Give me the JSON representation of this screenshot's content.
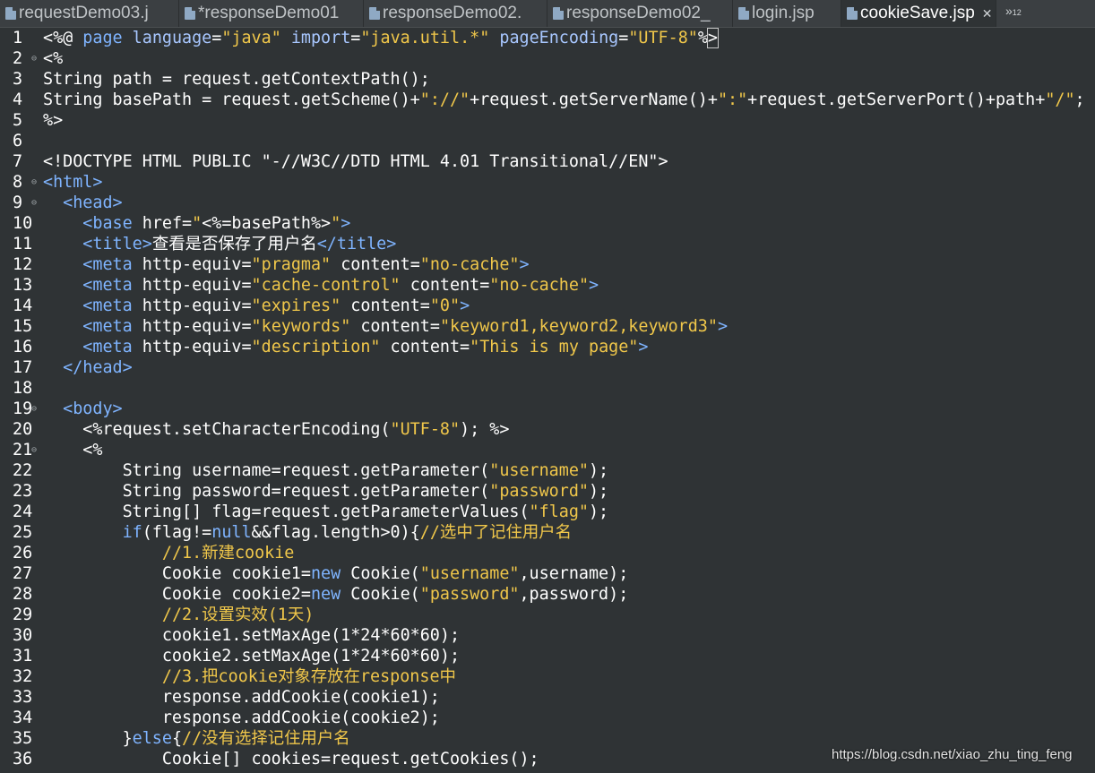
{
  "tabs": [
    {
      "label": "requestDemo03.j",
      "active": false
    },
    {
      "label": "*responseDemo01",
      "active": false
    },
    {
      "label": "responseDemo02.",
      "active": false
    },
    {
      "label": "responseDemo02_",
      "active": false
    },
    {
      "label": "login.jsp",
      "active": false
    },
    {
      "label": "cookieSave.jsp",
      "active": true
    }
  ],
  "tab_close": "✕",
  "overflow_count": "12",
  "overflow_glyph": "»",
  "colors": {
    "background": "#2f3335",
    "keyword": "#7fb4ff",
    "string": "#f0c74a",
    "text": "#ffffff"
  },
  "lines": [
    {
      "n": "1",
      "fold": false,
      "tokens": [
        [
          "plain",
          "<%@ "
        ],
        [
          "kw",
          "page"
        ],
        [
          "plain",
          " "
        ],
        [
          "attr",
          "language"
        ],
        [
          "plain",
          "="
        ],
        [
          "str",
          "\"java\""
        ],
        [
          "plain",
          " "
        ],
        [
          "attr",
          "import"
        ],
        [
          "plain",
          "="
        ],
        [
          "str",
          "\"java.util.*\""
        ],
        [
          "plain",
          " "
        ],
        [
          "attr",
          "pageEncoding"
        ],
        [
          "plain",
          "="
        ],
        [
          "str",
          "\"UTF-8\""
        ],
        [
          "plain",
          "%"
        ],
        [
          "plain",
          ">"
        ]
      ]
    },
    {
      "n": "2",
      "fold": true,
      "tokens": [
        [
          "plain",
          "<%"
        ]
      ]
    },
    {
      "n": "3",
      "fold": false,
      "tokens": [
        [
          "plain",
          "String path = request.getContextPath();"
        ]
      ]
    },
    {
      "n": "4",
      "fold": false,
      "tokens": [
        [
          "plain",
          "String basePath = request.getScheme()+"
        ],
        [
          "str",
          "\"://\""
        ],
        [
          "plain",
          "+request.getServerName()+"
        ],
        [
          "str",
          "\":\""
        ],
        [
          "plain",
          "+request.getServerPort()+path+"
        ],
        [
          "str",
          "\"/\""
        ],
        [
          "plain",
          ";"
        ]
      ]
    },
    {
      "n": "5",
      "fold": false,
      "tokens": [
        [
          "plain",
          "%>"
        ]
      ]
    },
    {
      "n": "6",
      "fold": false,
      "tokens": []
    },
    {
      "n": "7",
      "fold": false,
      "tokens": [
        [
          "plain",
          "<!DOCTYPE HTML PUBLIC \"-//W3C//DTD HTML 4.01 Transitional//EN\">"
        ]
      ]
    },
    {
      "n": "8",
      "fold": true,
      "tokens": [
        [
          "kw",
          "<html>"
        ]
      ]
    },
    {
      "n": "9",
      "fold": true,
      "tokens": [
        [
          "plain",
          "  "
        ],
        [
          "kw",
          "<head>"
        ]
      ]
    },
    {
      "n": "10",
      "fold": false,
      "tokens": [
        [
          "plain",
          "    "
        ],
        [
          "kw",
          "<base"
        ],
        [
          "plain",
          " href="
        ],
        [
          "str",
          "\""
        ],
        [
          "plain",
          "<%=basePath%>"
        ],
        [
          "str",
          "\""
        ],
        [
          "kw",
          ">"
        ]
      ]
    },
    {
      "n": "11",
      "fold": false,
      "tokens": [
        [
          "plain",
          "    "
        ],
        [
          "kw",
          "<title>"
        ],
        [
          "plain",
          "查看是否保存了用户名"
        ],
        [
          "kw",
          "</title>"
        ]
      ]
    },
    {
      "n": "12",
      "fold": false,
      "tokens": [
        [
          "plain",
          "    "
        ],
        [
          "kw",
          "<meta"
        ],
        [
          "plain",
          " http-equiv="
        ],
        [
          "str",
          "\"pragma\""
        ],
        [
          "plain",
          " content="
        ],
        [
          "str",
          "\"no-cache\""
        ],
        [
          "kw",
          ">"
        ]
      ]
    },
    {
      "n": "13",
      "fold": false,
      "tokens": [
        [
          "plain",
          "    "
        ],
        [
          "kw",
          "<meta"
        ],
        [
          "plain",
          " http-equiv="
        ],
        [
          "str",
          "\"cache-control\""
        ],
        [
          "plain",
          " content="
        ],
        [
          "str",
          "\"no-cache\""
        ],
        [
          "kw",
          ">"
        ]
      ]
    },
    {
      "n": "14",
      "fold": false,
      "tokens": [
        [
          "plain",
          "    "
        ],
        [
          "kw",
          "<meta"
        ],
        [
          "plain",
          " http-equiv="
        ],
        [
          "str",
          "\"expires\""
        ],
        [
          "plain",
          " content="
        ],
        [
          "str",
          "\"0\""
        ],
        [
          "kw",
          ">"
        ]
      ]
    },
    {
      "n": "15",
      "fold": false,
      "tokens": [
        [
          "plain",
          "    "
        ],
        [
          "kw",
          "<meta"
        ],
        [
          "plain",
          " http-equiv="
        ],
        [
          "str",
          "\"keywords\""
        ],
        [
          "plain",
          " content="
        ],
        [
          "str",
          "\"keyword1,keyword2,keyword3\""
        ],
        [
          "kw",
          ">"
        ]
      ]
    },
    {
      "n": "16",
      "fold": false,
      "tokens": [
        [
          "plain",
          "    "
        ],
        [
          "kw",
          "<meta"
        ],
        [
          "plain",
          " http-equiv="
        ],
        [
          "str",
          "\"description\""
        ],
        [
          "plain",
          " content="
        ],
        [
          "str",
          "\"This is my page\""
        ],
        [
          "kw",
          ">"
        ]
      ]
    },
    {
      "n": "17",
      "fold": false,
      "tokens": [
        [
          "plain",
          "  "
        ],
        [
          "kw",
          "</head>"
        ]
      ]
    },
    {
      "n": "18",
      "fold": false,
      "tokens": []
    },
    {
      "n": "19",
      "fold": true,
      "tokens": [
        [
          "plain",
          "  "
        ],
        [
          "kw",
          "<body>"
        ]
      ]
    },
    {
      "n": "20",
      "fold": false,
      "tokens": [
        [
          "plain",
          "    <%request.setCharacterEncoding("
        ],
        [
          "str",
          "\"UTF-8\""
        ],
        [
          "plain",
          "); %>"
        ]
      ]
    },
    {
      "n": "21",
      "fold": true,
      "tokens": [
        [
          "plain",
          "    <%"
        ]
      ]
    },
    {
      "n": "22",
      "fold": false,
      "tokens": [
        [
          "plain",
          "        String username=request.getParameter("
        ],
        [
          "str",
          "\"username\""
        ],
        [
          "plain",
          ");"
        ]
      ]
    },
    {
      "n": "23",
      "fold": false,
      "tokens": [
        [
          "plain",
          "        String password=request.getParameter("
        ],
        [
          "str",
          "\"password\""
        ],
        [
          "plain",
          ");"
        ]
      ]
    },
    {
      "n": "24",
      "fold": false,
      "tokens": [
        [
          "plain",
          "        String[] flag=request.getParameterValues("
        ],
        [
          "str",
          "\"flag\""
        ],
        [
          "plain",
          ");"
        ]
      ]
    },
    {
      "n": "25",
      "fold": false,
      "tokens": [
        [
          "plain",
          "        "
        ],
        [
          "kw",
          "if"
        ],
        [
          "plain",
          "(flag!="
        ],
        [
          "kw",
          "null"
        ],
        [
          "plain",
          "&&flag.length>0){"
        ],
        [
          "cmt",
          "//选中了记住用户名"
        ]
      ]
    },
    {
      "n": "26",
      "fold": false,
      "tokens": [
        [
          "plain",
          "            "
        ],
        [
          "cmt",
          "//1.新建cookie"
        ]
      ]
    },
    {
      "n": "27",
      "fold": false,
      "tokens": [
        [
          "plain",
          "            Cookie cookie1="
        ],
        [
          "kw",
          "new"
        ],
        [
          "plain",
          " Cookie("
        ],
        [
          "str",
          "\"username\""
        ],
        [
          "plain",
          ",username);"
        ]
      ]
    },
    {
      "n": "28",
      "fold": false,
      "tokens": [
        [
          "plain",
          "            Cookie cookie2="
        ],
        [
          "kw",
          "new"
        ],
        [
          "plain",
          " Cookie("
        ],
        [
          "str",
          "\"password\""
        ],
        [
          "plain",
          ",password);"
        ]
      ]
    },
    {
      "n": "29",
      "fold": false,
      "tokens": [
        [
          "plain",
          "            "
        ],
        [
          "cmt",
          "//2.设置实效(1天)"
        ]
      ]
    },
    {
      "n": "30",
      "fold": false,
      "tokens": [
        [
          "plain",
          "            cookie1.setMaxAge(1*24*60*60);"
        ]
      ]
    },
    {
      "n": "31",
      "fold": false,
      "tokens": [
        [
          "plain",
          "            cookie2.setMaxAge(1*24*60*60);"
        ]
      ]
    },
    {
      "n": "32",
      "fold": false,
      "tokens": [
        [
          "plain",
          "            "
        ],
        [
          "cmt",
          "//3.把cookie对象存放在response中"
        ]
      ]
    },
    {
      "n": "33",
      "fold": false,
      "tokens": [
        [
          "plain",
          "            response.addCookie(cookie1);"
        ]
      ]
    },
    {
      "n": "34",
      "fold": false,
      "tokens": [
        [
          "plain",
          "            response.addCookie(cookie2);"
        ]
      ]
    },
    {
      "n": "35",
      "fold": false,
      "tokens": [
        [
          "plain",
          "        }"
        ],
        [
          "kw",
          "else"
        ],
        [
          "plain",
          "{"
        ],
        [
          "cmt",
          "//没有选择记住用户名"
        ]
      ]
    },
    {
      "n": "36",
      "fold": false,
      "tokens": [
        [
          "plain",
          "            Cookie[] cookies=request.getCookies();"
        ]
      ]
    }
  ],
  "watermark": "https://blog.csdn.net/xiao_zhu_ting_feng"
}
